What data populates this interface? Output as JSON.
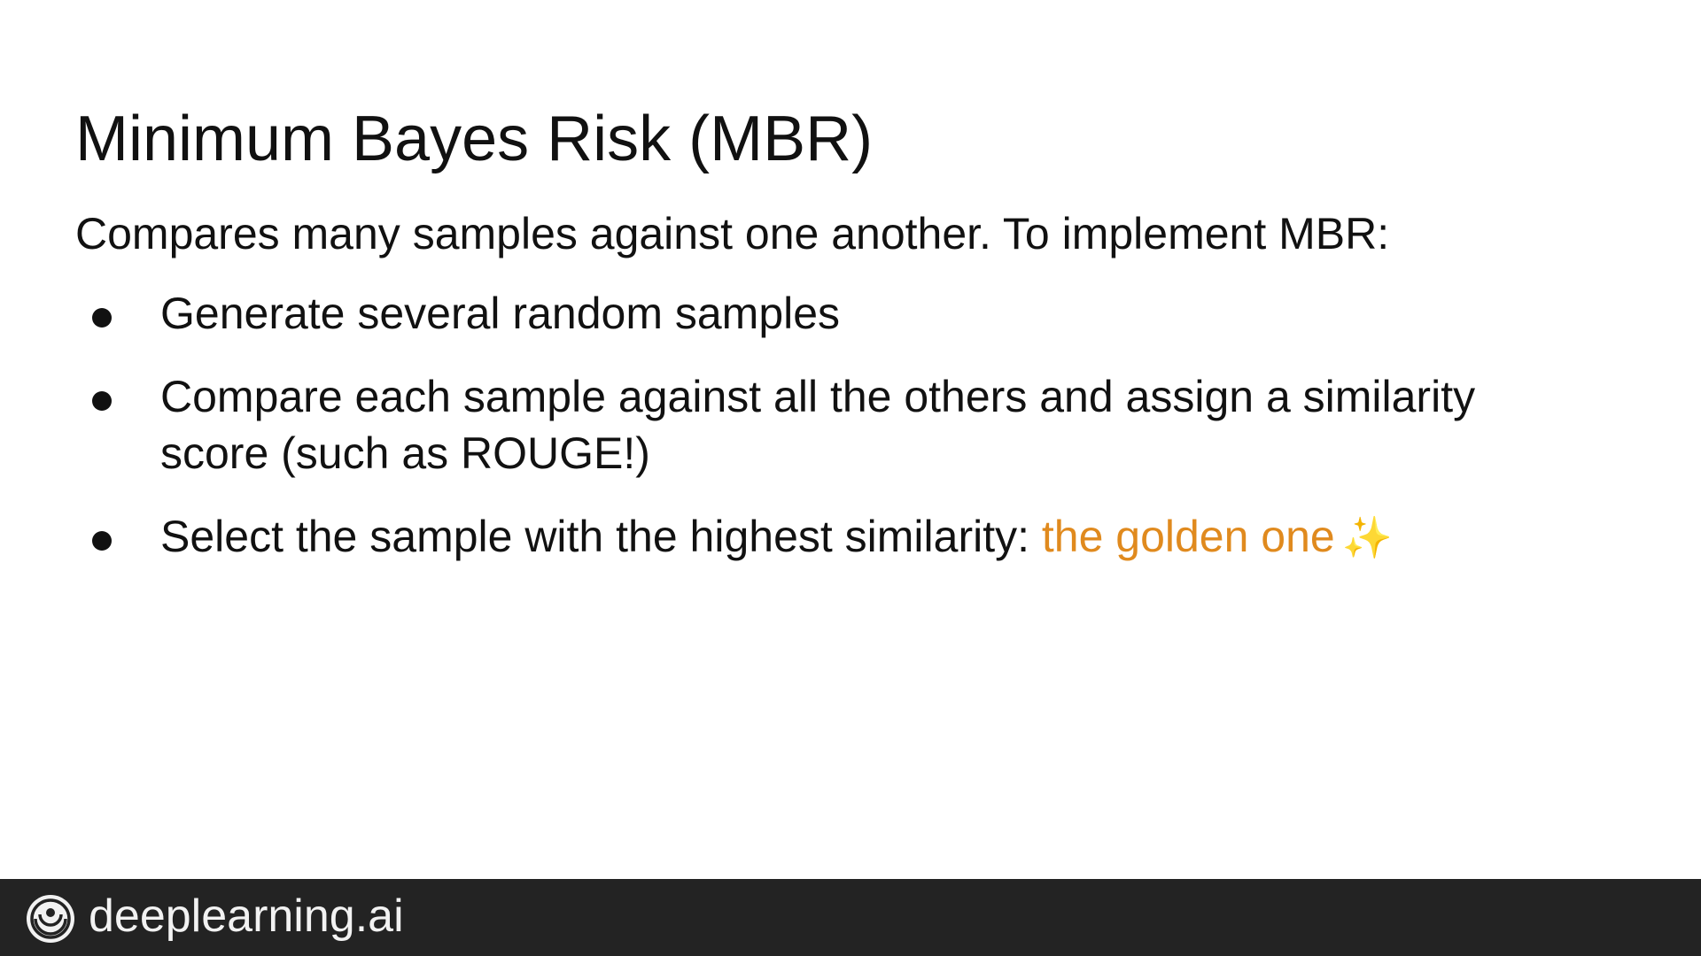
{
  "slide": {
    "title": "Minimum Bayes Risk (MBR)",
    "intro": "Compares many samples against one another. To implement MBR:",
    "bullets": [
      {
        "text": "Generate several random samples"
      },
      {
        "text": "Compare each sample against all the others and assign a similarity score (such as ROUGE!)"
      },
      {
        "text": "Select the sample with the highest similarity: ",
        "highlight": "the golden one",
        "emoji": "✨"
      }
    ]
  },
  "footer": {
    "brand": "deeplearning.ai",
    "logo_icon": "deeplearning-ai-logo-icon"
  },
  "colors": {
    "highlight": "#e08a1e",
    "footer_background": "#232323",
    "text": "#111111"
  }
}
